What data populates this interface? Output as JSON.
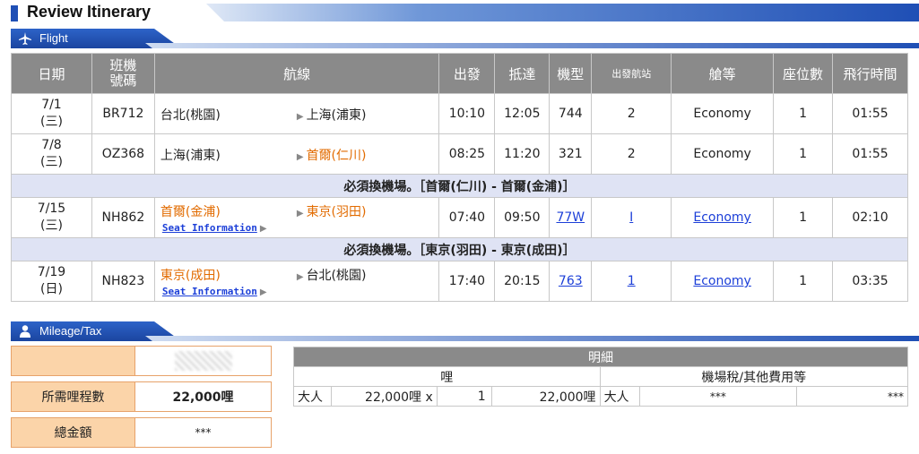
{
  "page": {
    "title": "Review Itinerary"
  },
  "flight_section": {
    "label": "Flight"
  },
  "flight_table": {
    "headers": [
      "日期",
      "班機號碼",
      "航線",
      "出發",
      "抵達",
      "機型",
      "出發航站",
      "艙等",
      "座位數",
      "飛行時間"
    ],
    "rows": [
      {
        "date": "7/1",
        "weekday": "(三)",
        "flight": "BR712",
        "from": "台北(桃園)",
        "to": "上海(浦東)",
        "dep": "10:10",
        "arr": "12:05",
        "aircraft": "744",
        "terminal": "2",
        "cabin": "Economy",
        "seats": "1",
        "duration": "01:55"
      },
      {
        "date": "7/8",
        "weekday": "(三)",
        "flight": "OZ368",
        "from": "上海(浦東)",
        "to": "首爾(仁川)",
        "dep": "08:25",
        "arr": "11:20",
        "aircraft": "321",
        "terminal": "2",
        "cabin": "Economy",
        "seats": "1",
        "duration": "01:55"
      },
      {
        "date": "7/15",
        "weekday": "(三)",
        "flight": "NH862",
        "from": "首爾(金浦)",
        "to": "東京(羽田)",
        "dep": "07:40",
        "arr": "09:50",
        "aircraft": "77W",
        "terminal": "I",
        "cabin": "Economy",
        "seats": "1",
        "duration": "02:10",
        "seat_info": "Seat Information"
      },
      {
        "date": "7/19",
        "weekday": "(日)",
        "flight": "NH823",
        "from": "東京(成田)",
        "to": "台北(桃園)",
        "dep": "17:40",
        "arr": "20:15",
        "aircraft": "763",
        "terminal": "1",
        "cabin": "Economy",
        "seats": "1",
        "duration": "03:35",
        "seat_info": "Seat Information"
      }
    ],
    "transfer_1": "必須換機場。［首爾(仁川) - 首爾(金浦)］",
    "transfer_2": "必須換機場。［東京(羽田) - 東京(成田)］"
  },
  "mileage_section": {
    "label": "Mileage/Tax"
  },
  "mileage": {
    "required_label": "所需哩程數",
    "required_value": "22,000哩",
    "total_label": "總金額",
    "total_value": "***"
  },
  "detail": {
    "header": "明細",
    "miles_header": "哩",
    "tax_header": "機場稅/其他費用等",
    "pax_label": "大人",
    "miles_each": "22,000哩",
    "times": "x",
    "count": "1",
    "miles_total": "22,000哩",
    "tax_pax_label": "大人",
    "tax_each": "***",
    "tax_total": "***"
  },
  "colors": {
    "accent": "#1f4fb5",
    "table_header": "#8a8a8a",
    "transfer_bg": "#dfe3f4",
    "orange_text": "#e26b00",
    "link": "#1c3fd8",
    "mileage_label_bg": "#fbd4a9"
  }
}
